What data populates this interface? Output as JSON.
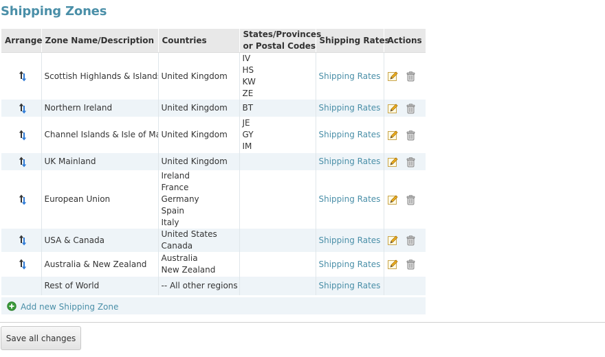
{
  "page": {
    "title": "Shipping Zones"
  },
  "table": {
    "headers": {
      "arrange": "Arrange",
      "zone": "Zone Name/Description",
      "countries": "Countries",
      "states_line1": "States/Provinces",
      "states_line2": "or Postal Codes",
      "rates": "Shipping Rates",
      "actions": "Actions"
    },
    "rows": [
      {
        "name": "Scottish Highlands & Islands",
        "countries": [
          "United Kingdom"
        ],
        "codes": [
          "IV",
          "HS",
          "KW",
          "ZE"
        ],
        "rates_link": "Shipping Rates",
        "sortable": true
      },
      {
        "name": "Northern Ireland",
        "countries": [
          "United Kingdom"
        ],
        "codes": [
          "BT"
        ],
        "rates_link": "Shipping Rates",
        "sortable": true
      },
      {
        "name": "Channel Islands & Isle of Man",
        "countries": [
          "United Kingdom"
        ],
        "codes": [
          "JE",
          "GY",
          "IM"
        ],
        "rates_link": "Shipping Rates",
        "sortable": true
      },
      {
        "name": "UK Mainland",
        "countries": [
          "United Kingdom"
        ],
        "codes": [],
        "rates_link": "Shipping Rates",
        "sortable": true
      },
      {
        "name": "European Union",
        "countries": [
          "Ireland",
          "France",
          "Germany",
          "Spain",
          "Italy"
        ],
        "codes": [],
        "rates_link": "Shipping Rates",
        "sortable": true
      },
      {
        "name": "USA & Canada",
        "countries": [
          "United States",
          "Canada"
        ],
        "codes": [],
        "rates_link": "Shipping Rates",
        "sortable": true
      },
      {
        "name": "Australia & New Zealand",
        "countries": [
          "Australia",
          "New Zealand"
        ],
        "codes": [],
        "rates_link": "Shipping Rates",
        "sortable": true
      },
      {
        "name": "Rest of World",
        "countries": [
          "-- All other regions --"
        ],
        "codes": [],
        "rates_link": "Shipping Rates",
        "sortable": false
      }
    ]
  },
  "add_zone": {
    "label": "Add new Shipping Zone",
    "icon": "plus-circle-icon"
  },
  "save_button": {
    "label": "Save all changes"
  },
  "icons": {
    "arrange": "up-down-arrow-icon",
    "edit": "pencil-icon",
    "delete": "trash-can-icon"
  },
  "colors": {
    "accent": "#4a8fa8",
    "header_bg": "#e8e8e8",
    "alt_row_bg": "#eef4f8",
    "plus_green": "#3a9a3a"
  }
}
